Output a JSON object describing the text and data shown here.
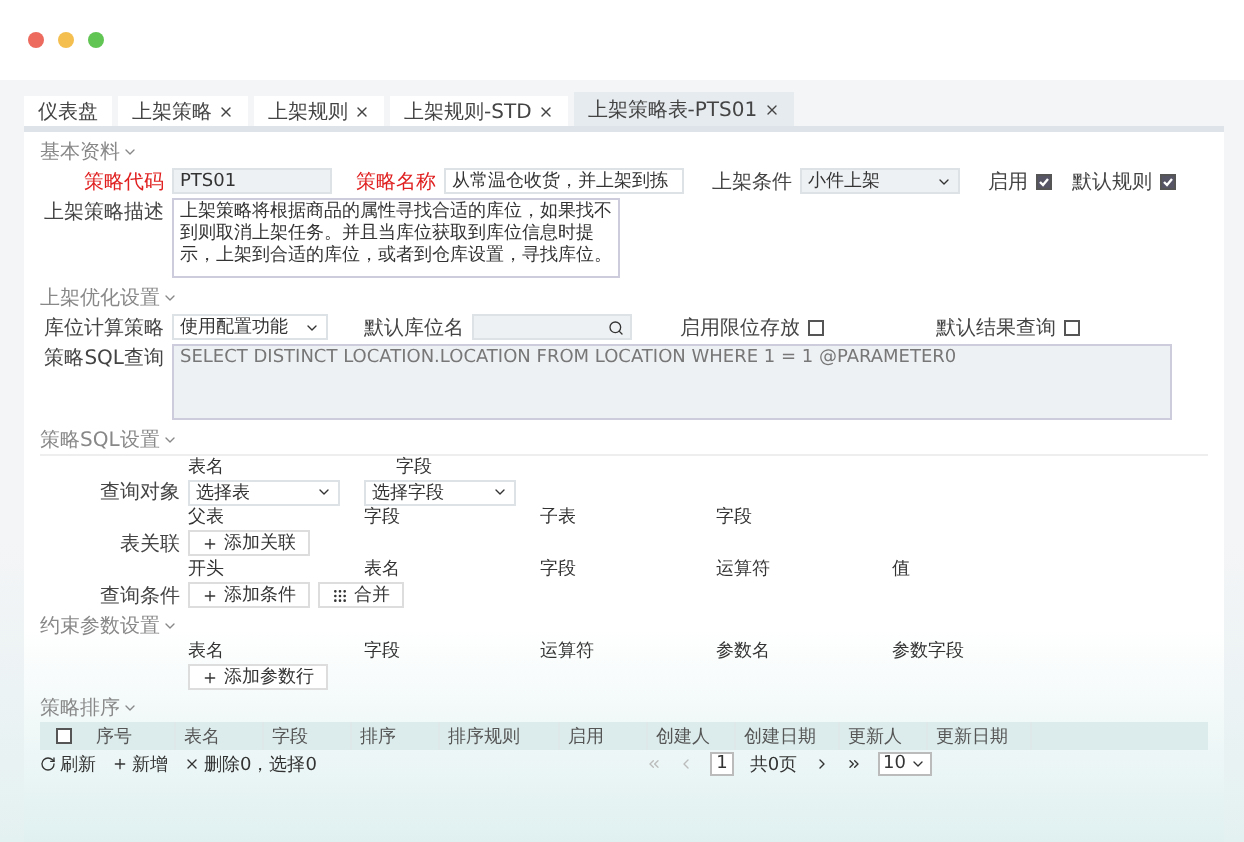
{
  "tabs": [
    {
      "label": "仪表盘",
      "closable": false,
      "selected": false
    },
    {
      "label": "上架策略",
      "closable": true,
      "selected": false
    },
    {
      "label": "上架规则",
      "closable": true,
      "selected": false
    },
    {
      "label": "上架规则-STD",
      "closable": true,
      "selected": false
    },
    {
      "label": "上架策略表-PTS01",
      "closable": true,
      "selected": true
    }
  ],
  "basic_info": {
    "title": "基本资料",
    "code": {
      "label": "策略代码",
      "required": true,
      "value": "PTS01"
    },
    "name": {
      "label": "策略名称",
      "required": true,
      "value": "从常温仓收货，并上架到拣"
    },
    "condition": {
      "label": "上架条件",
      "value": "小件上架"
    },
    "enabled": {
      "label": "启用",
      "checked": true
    },
    "default_rule": {
      "label": "默认规则",
      "checked": true
    },
    "description": {
      "label": "上架策略描述",
      "value": "上架策略将根据商品的属性寻找合适的库位，如果找不到则取消上架任务。并且当库位获取到库位信息时提示，上架到合适的库位，或者到仓库设置，寻找库位。"
    }
  },
  "optimization": {
    "title": "上架优化设置",
    "calc_strategy": {
      "label": "库位计算策略",
      "value": "使用配置功能"
    },
    "default_location": {
      "label": "默认库位名"
    },
    "limit_storage": {
      "label": "启用限位存放",
      "checked": false
    },
    "default_query": {
      "label": "默认结果查询",
      "checked": false
    },
    "sql": {
      "label": "策略SQL查询",
      "value": "SELECT DISTINCT LOCATION.LOCATION FROM LOCATION WHERE 1 = 1 @PARAMETER0"
    }
  },
  "sql_settings": {
    "title": "策略SQL设置",
    "query_object": {
      "label": "查询对象",
      "table": {
        "label": "表名",
        "value": "选择表"
      },
      "field": {
        "label": "字段",
        "value": "选择字段"
      }
    },
    "join": {
      "label": "表关联",
      "columns": [
        "父表",
        "字段",
        "子表",
        "字段"
      ],
      "buttons": [
        {
          "kind": "add",
          "label": "添加关联"
        }
      ]
    },
    "conditions": {
      "label": "查询条件",
      "columns": [
        "开头",
        "表名",
        "字段",
        "运算符",
        "值"
      ],
      "buttons": [
        {
          "kind": "add",
          "label": "添加条件"
        },
        {
          "kind": "merge",
          "label": "合并"
        }
      ]
    }
  },
  "constraints": {
    "title": "约束参数设置",
    "columns": [
      "表名",
      "字段",
      "运算符",
      "参数名",
      "参数字段"
    ],
    "buttons": [
      {
        "kind": "add",
        "label": "添加参数行"
      }
    ]
  },
  "sorting": {
    "title": "策略排序",
    "select_all_checked": false,
    "columns": [
      "序号",
      "表名",
      "字段",
      "排序",
      "排序规则",
      "启用",
      "创建人",
      "创建日期",
      "更新人",
      "更新日期"
    ],
    "actions": [
      {
        "kind": "refresh",
        "label": "刷新"
      },
      {
        "kind": "add",
        "label": "新增"
      },
      {
        "kind": "delete",
        "label": "删除0，选择0"
      }
    ],
    "page": "1",
    "page_total": "共0页",
    "page_size": "10"
  }
}
